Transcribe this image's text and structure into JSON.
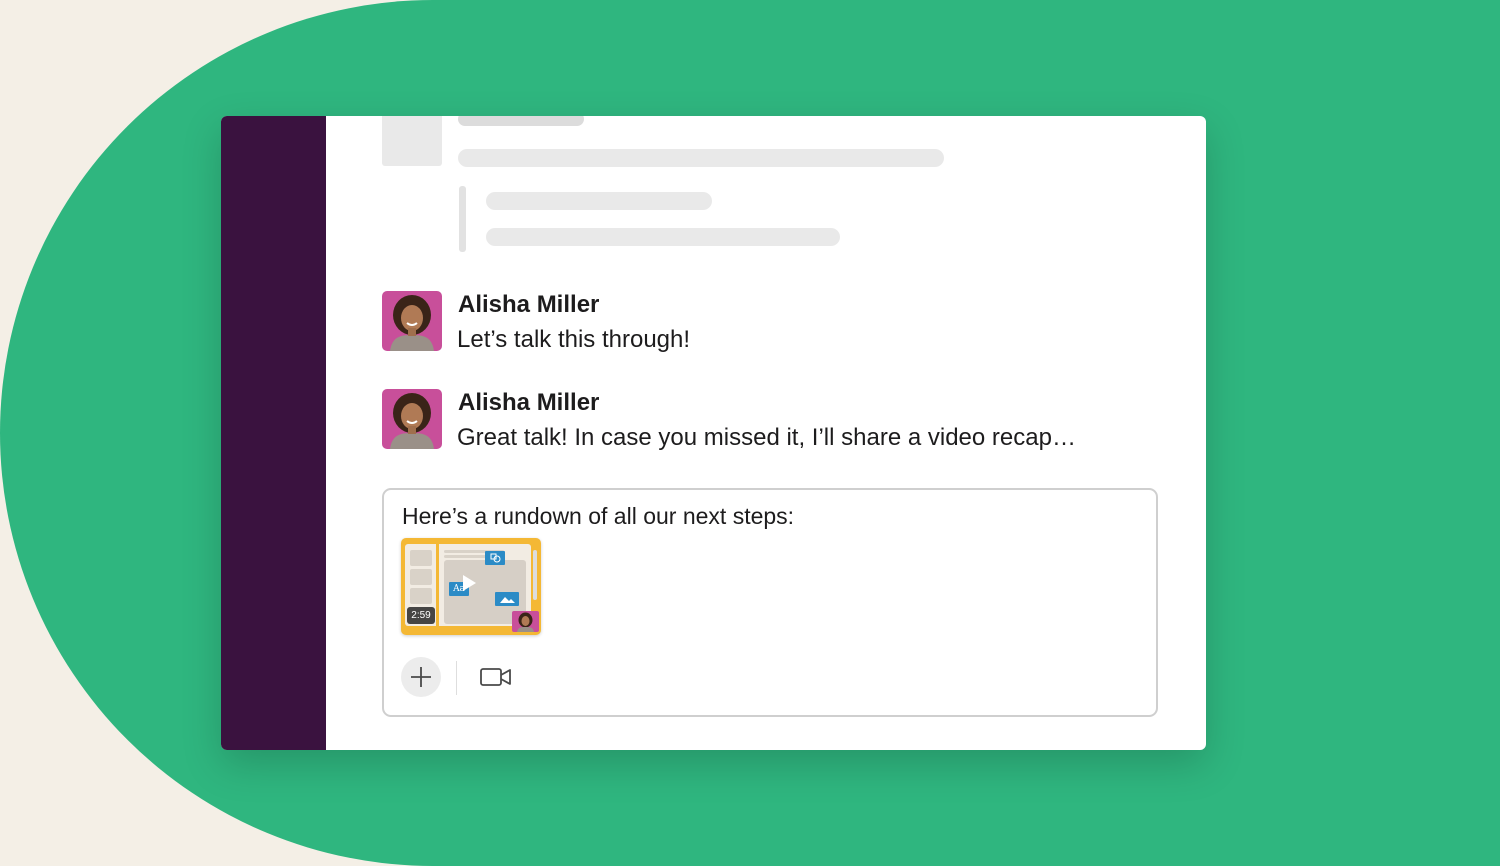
{
  "colors": {
    "background_cream": "#f4efe6",
    "background_green": "#2fb67f",
    "sidebar": "#3a123f",
    "thumbnail_frame": "#f4b835",
    "thumbnail_chip": "#2b8bc6",
    "avatar_bg": "#c84f9a"
  },
  "messages": [
    {
      "sender": "Alisha Miller",
      "text": "Let’s talk this through!"
    },
    {
      "sender": "Alisha Miller",
      "text": "Great talk! In case you missed it, I’ll share a video recap…"
    }
  ],
  "composer": {
    "text": "Here’s a rundown of all our next steps:",
    "attachment": {
      "type": "video",
      "duration": "2:59",
      "text_chip": "Aa",
      "icons": [
        "play-icon",
        "image-icon",
        "shapes-icon"
      ]
    },
    "toolbar": {
      "icons": [
        "plus-icon",
        "video-camera-icon"
      ]
    }
  }
}
